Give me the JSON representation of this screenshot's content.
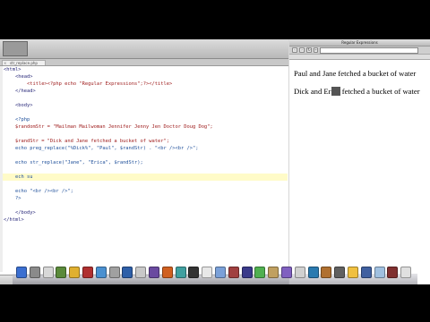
{
  "editor": {
    "tab_label": "str_replace.php",
    "code_lines": [
      "<html>",
      "    <head>",
      "        <title><?php echo \"Regular Expressions\";?></title>",
      "    </head>",
      "",
      "    <body>",
      "",
      "    <?php",
      "    $randomStr = \"Mailman Mailwoman Jennifer Jenny Jen Doctor Doug Dog\";",
      "",
      "    $randStr = \"Dick and Jane fetched a bucket of water\";",
      "    echo preg_replace(\"%Dick%\", \"Paul\", $randStr) . \"<br /><br />\";",
      "",
      "    echo str_replace(\"Jane\", \"Erica\", $randStr);",
      "",
      "    ech su",
      "",
      "    echo \"<br /><br />\";",
      "    ?>",
      "",
      "    </body>",
      "</html>"
    ]
  },
  "browser": {
    "window_title": "Regular Expressions",
    "output_line_1": "Paul and Jane fetched a bucket of water",
    "output_line_2_before": "Dick and Er",
    "output_line_2_selected": "ica",
    "output_line_2_after": " fetched a bucket of water"
  },
  "dock": {
    "icon_colors": [
      "#3b6fd1",
      "#8a8a8a",
      "#d8d8d8",
      "#5a8a3a",
      "#e0b030",
      "#b03030",
      "#4a90d0",
      "#a0a0a0",
      "#2e5fa8",
      "#c8c8c8",
      "#6a4aa0",
      "#d06020",
      "#40a0a0",
      "#333333",
      "#e8e8e8",
      "#7aa0d8",
      "#a04040",
      "#3a3a8a",
      "#50b050",
      "#c0a060",
      "#8060c0",
      "#d0d0d0",
      "#2a7ab0",
      "#b07030",
      "#606060",
      "#f0c040",
      "#4060a0",
      "#a0c0e0",
      "#803030",
      "#e0e0e0"
    ]
  }
}
